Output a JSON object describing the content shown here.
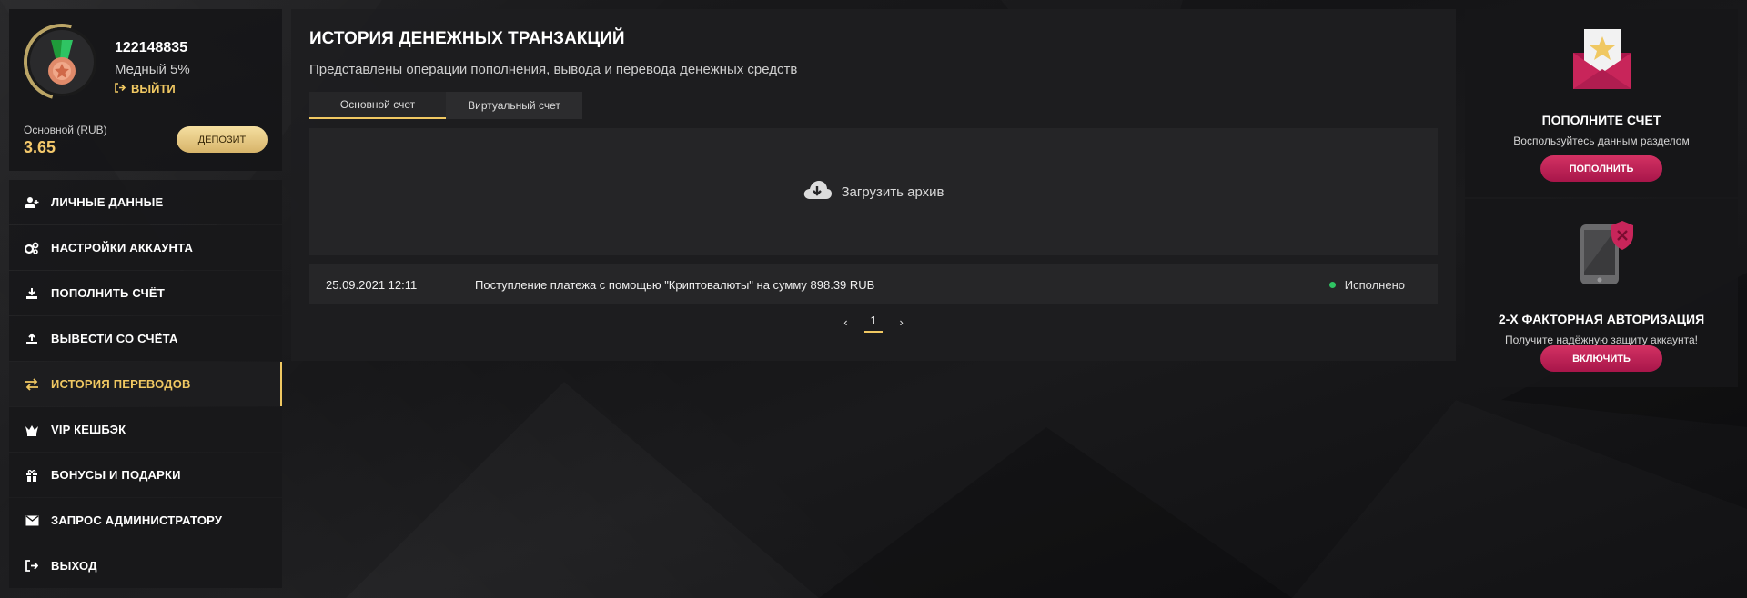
{
  "profile": {
    "user_id": "122148835",
    "level": "Медный 5%",
    "logout_label": "ВЫЙТИ",
    "balance_label": "Основной (RUB)",
    "balance_value": "3.65",
    "deposit_label": "ДЕПОЗИТ"
  },
  "menu": {
    "items": [
      {
        "label": "ЛИЧНЫЕ ДАННЫЕ",
        "icon": "user-add-icon"
      },
      {
        "label": "НАСТРОЙКИ АККАУНТА",
        "icon": "gears-icon"
      },
      {
        "label": "ПОПОЛНИТЬ СЧЁТ",
        "icon": "download-icon"
      },
      {
        "label": "ВЫВЕСТИ СО СЧЁТА",
        "icon": "upload-icon"
      },
      {
        "label": "ИСТОРИЯ ПЕРЕВОДОВ",
        "icon": "exchange-icon",
        "active": true
      },
      {
        "label": "VIP КЕШБЭК",
        "icon": "crown-icon"
      },
      {
        "label": "БОНУСЫ И ПОДАРКИ",
        "icon": "gift-icon"
      },
      {
        "label": "ЗАПРОС АДМИНИСТРАТОРУ",
        "icon": "envelope-icon"
      },
      {
        "label": "ВЫХОД",
        "icon": "sign-out-icon"
      }
    ]
  },
  "main": {
    "title": "ИСТОРИЯ ДЕНЕЖНЫХ ТРАНЗАКЦИЙ",
    "subtitle": "Представлены операции пополнения, вывода и перевода денежных средств",
    "tabs": [
      {
        "label": "Основной счет",
        "active": true
      },
      {
        "label": "Виртуальный счет",
        "active": false
      }
    ],
    "archive_label": "Загрузить архив",
    "transactions": [
      {
        "date": "25.09.2021 12:11",
        "description": "Поступление платежа с помощью \"Криптовалюты\" на сумму 898.39 RUB",
        "status": "Исполнено"
      }
    ],
    "pagination": {
      "current": "1"
    }
  },
  "sidebar_right": {
    "deposit_card": {
      "title": "ПОПОЛНИТЕ СЧЕТ",
      "text": "Воспользуйтесь данным разделом",
      "button": "ПОПОЛНИТЬ"
    },
    "twofa_card": {
      "title": "2-Х ФАКТОРНАЯ АВТОРИЗАЦИЯ",
      "text": "Получите надёжную защиту аккаунта!",
      "button": "ВКЛЮЧИТЬ"
    }
  },
  "colors": {
    "accent_gold": "#f0c862",
    "accent_pink": "#c8255a",
    "status_green": "#2fc463"
  }
}
